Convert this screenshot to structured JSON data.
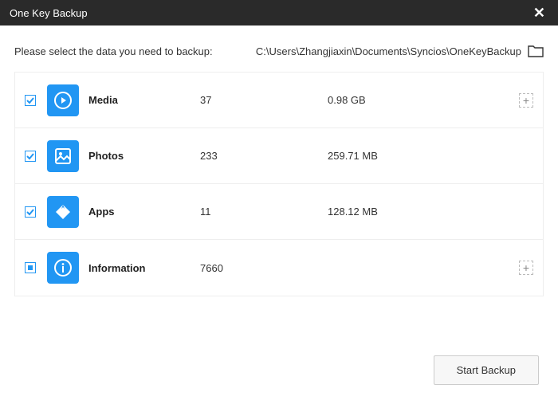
{
  "window": {
    "title": "One Key Backup"
  },
  "prompt": "Please select the data you need to backup:",
  "path": "C:\\Users\\Zhangjiaxin\\Documents\\Syncios\\OneKeyBackup",
  "items": [
    {
      "name": "Media",
      "count": "37",
      "size": "0.98 GB",
      "checked": true,
      "indeterminate": false,
      "icon": "play-icon",
      "expandable": true
    },
    {
      "name": "Photos",
      "count": "233",
      "size": "259.71 MB",
      "checked": true,
      "indeterminate": false,
      "icon": "photo-icon",
      "expandable": false
    },
    {
      "name": "Apps",
      "count": "11",
      "size": "128.12 MB",
      "checked": true,
      "indeterminate": false,
      "icon": "apps-icon",
      "expandable": false
    },
    {
      "name": "Information",
      "count": "7660",
      "size": "",
      "checked": false,
      "indeterminate": true,
      "icon": "info-icon",
      "expandable": true
    }
  ],
  "footer": {
    "start_label": "Start Backup"
  }
}
